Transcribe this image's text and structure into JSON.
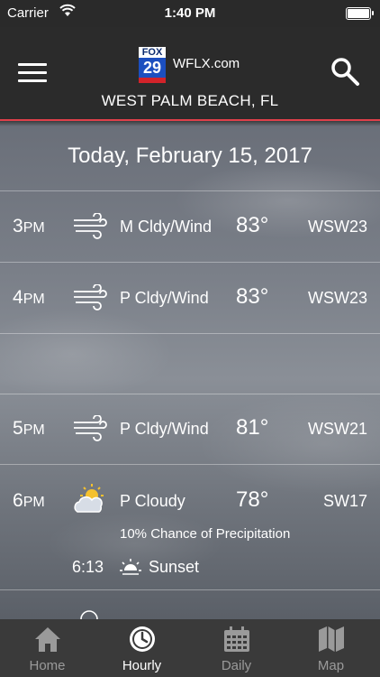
{
  "status_bar": {
    "carrier": "Carrier",
    "time": "1:40 PM"
  },
  "header": {
    "logo_top": "FOX",
    "logo_number": "29",
    "site": "WFLX.com",
    "location": "WEST PALM BEACH, FL"
  },
  "date": "Today, February 15, 2017",
  "hours": [
    {
      "hour": "3",
      "ampm": "PM",
      "icon": "wind-icon",
      "condition": "M Cldy/Wind",
      "temp": "83°",
      "wind": "WSW23"
    },
    {
      "hour": "4",
      "ampm": "PM",
      "icon": "wind-icon",
      "condition": "P Cldy/Wind",
      "temp": "83°",
      "wind": "WSW23"
    },
    {
      "hour": "5",
      "ampm": "PM",
      "icon": "wind-icon",
      "condition": "P Cldy/Wind",
      "temp": "81°",
      "wind": "WSW21"
    },
    {
      "hour": "6",
      "ampm": "PM",
      "icon": "partly-cloudy-icon",
      "condition": "P Cloudy",
      "temp": "78°",
      "wind": "SW17",
      "precip": "10% Chance of Precipitation",
      "sun_time": "6:13",
      "sun_label": "Sunset"
    }
  ],
  "tabs": [
    {
      "label": "Home",
      "icon": "home-icon"
    },
    {
      "label": "Hourly",
      "icon": "clock-icon",
      "active": true
    },
    {
      "label": "Daily",
      "icon": "calendar-icon"
    },
    {
      "label": "Map",
      "icon": "map-icon"
    }
  ]
}
